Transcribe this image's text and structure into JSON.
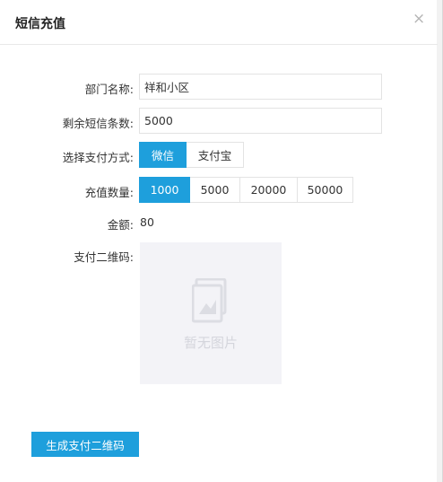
{
  "dialog": {
    "title": "短信充值",
    "close_glyph": "×"
  },
  "form": {
    "department": {
      "label": "部门名称:",
      "value": "祥和小区"
    },
    "remaining_sms": {
      "label": "剩余短信条数:",
      "value": "5000"
    },
    "payment_method": {
      "label": "选择支付方式:",
      "options": [
        "微信",
        "支付宝"
      ],
      "selected": "微信"
    },
    "quantity": {
      "label": "充值数量:",
      "options": [
        "1000",
        "5000",
        "20000",
        "50000"
      ],
      "selected": "1000"
    },
    "amount": {
      "label": "金额:",
      "value": "80"
    },
    "qr_code": {
      "label": "支付二维码:",
      "placeholder_text": "暂无图片",
      "icon": "no-image-icon"
    }
  },
  "actions": {
    "generate_label": "生成支付二维码"
  },
  "colors": {
    "accent": "#1e9fdc",
    "placeholder_bg": "#f3f3f7"
  }
}
